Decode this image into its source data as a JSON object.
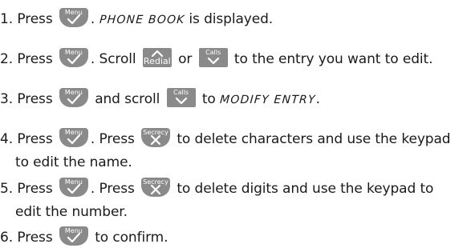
{
  "steps": [
    {
      "num": "1.",
      "segments": [
        {
          "t": "text",
          "v": " Press "
        },
        {
          "t": "key",
          "k": "menu"
        },
        {
          "t": "text",
          "v": ". "
        },
        {
          "t": "lcd",
          "v": "PHONE BOOK"
        },
        {
          "t": "text",
          "v": " is displayed."
        }
      ]
    },
    {
      "num": "2.",
      "segments": [
        {
          "t": "text",
          "v": " Press "
        },
        {
          "t": "key",
          "k": "menu"
        },
        {
          "t": "text",
          "v": ". Scroll "
        },
        {
          "t": "key",
          "k": "redial"
        },
        {
          "t": "text",
          "v": " or "
        },
        {
          "t": "key",
          "k": "calls"
        },
        {
          "t": "text",
          "v": " to the entry you want to edit."
        }
      ]
    },
    {
      "num": "3.",
      "segments": [
        {
          "t": "text",
          "v": " Press "
        },
        {
          "t": "key",
          "k": "menu"
        },
        {
          "t": "text",
          "v": " and scroll "
        },
        {
          "t": "key",
          "k": "calls"
        },
        {
          "t": "text",
          "v": " to "
        },
        {
          "t": "lcd",
          "v": "MODIFY ENTRY"
        },
        {
          "t": "text",
          "v": "."
        }
      ]
    },
    {
      "num": "4.",
      "segments": [
        {
          "t": "text",
          "v": " Press "
        },
        {
          "t": "key",
          "k": "menu"
        },
        {
          "t": "text",
          "v": ". Press "
        },
        {
          "t": "key",
          "k": "secrecy"
        },
        {
          "t": "text",
          "v": " to delete characters and use the keypad"
        },
        {
          "t": "br"
        },
        {
          "t": "text",
          "v": "to edit the name."
        }
      ]
    },
    {
      "num": "5.",
      "segments": [
        {
          "t": "text",
          "v": " Press "
        },
        {
          "t": "key",
          "k": "menu"
        },
        {
          "t": "text",
          "v": ". Press "
        },
        {
          "t": "key",
          "k": "secrecy"
        },
        {
          "t": "text",
          "v": " to delete digits and use the keypad to"
        },
        {
          "t": "br"
        },
        {
          "t": "text",
          "v": "edit the number."
        }
      ]
    },
    {
      "num": "6.",
      "segments": [
        {
          "t": "text",
          "v": " Press "
        },
        {
          "t": "key",
          "k": "menu"
        },
        {
          "t": "text",
          "v": " to confirm."
        }
      ]
    }
  ],
  "keys": {
    "menu": {
      "label": "Menu",
      "shape": "round",
      "glyph": "check",
      "icon": "menu-check-key-icon",
      "label_pos": "top"
    },
    "redial": {
      "label": "Redial",
      "shape": "square",
      "glyph": "up",
      "icon": "redial-up-key-icon",
      "label_pos": "bottom"
    },
    "calls": {
      "label": "Calls",
      "shape": "square",
      "glyph": "down",
      "icon": "calls-down-key-icon",
      "label_pos": "top"
    },
    "secrecy": {
      "label": "Secrecy",
      "shape": "round",
      "glyph": "cross",
      "icon": "secrecy-cross-key-icon",
      "label_pos": "top"
    }
  },
  "colors": {
    "key_fill": "#8a8a8a",
    "key_text": "#ffffff",
    "body_text": "#1a1a1a"
  }
}
